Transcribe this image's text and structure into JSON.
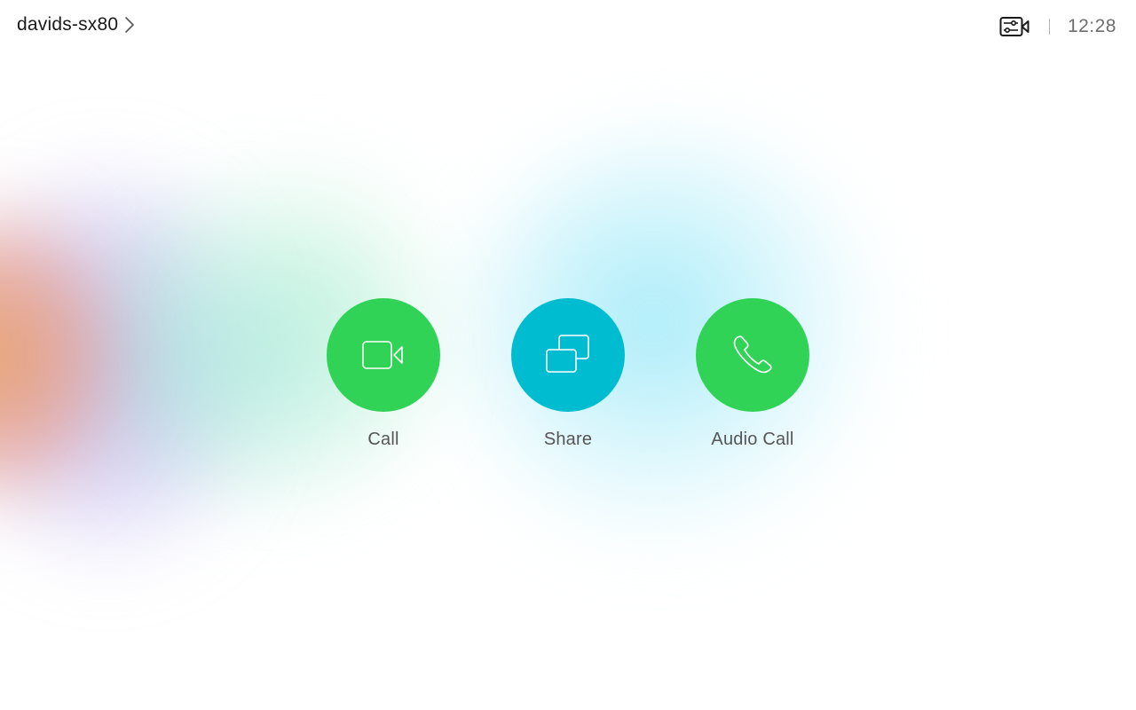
{
  "header": {
    "device_name": "davids-sx80",
    "clock": "12:28",
    "icons": {
      "device_chevron": "chevron-right-icon",
      "settings": "camera-settings-icon"
    }
  },
  "actions": [
    {
      "label": "Call",
      "icon": "video-camera-icon",
      "color": "#31d356"
    },
    {
      "label": "Share",
      "icon": "share-screens-icon",
      "color": "#00bcd0"
    },
    {
      "label": "Audio Call",
      "icon": "phone-handset-icon",
      "color": "#31d356"
    }
  ],
  "colors": {
    "call_green": "#31d356",
    "share_teal": "#00bcd0",
    "text_dark": "#1a1a1a",
    "text_gray": "#555555"
  }
}
